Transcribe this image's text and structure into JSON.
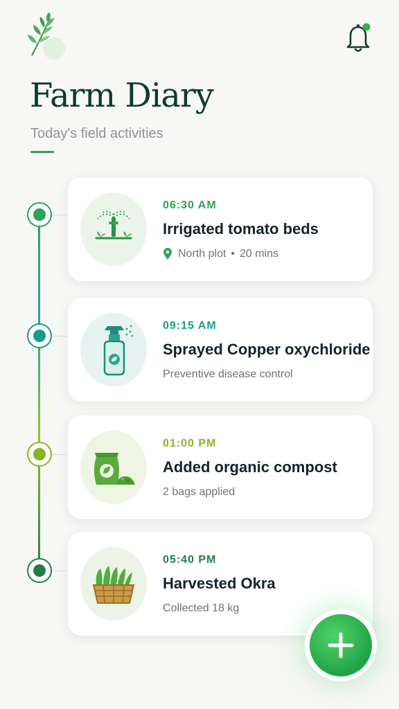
{
  "header": {
    "title": "Farm Diary",
    "subtitle": "Today's field activities",
    "logo_icon": "leaf-sprig-icon",
    "notification_icon": "bell-icon",
    "has_unread_notification": true
  },
  "colors": {
    "primary": "#2ea257",
    "title": "#0e3b2c",
    "teal": "#159c8f",
    "lime": "#8ab523",
    "dark_green": "#237e45"
  },
  "activities": [
    {
      "time": "06:30 AM",
      "title": "Irrigated tomato beds",
      "location": "North plot",
      "separator": "•",
      "duration": "20 mins",
      "icon": "sprinkler-icon",
      "accent": "#2ea257"
    },
    {
      "time": "09:15 AM",
      "title": "Sprayed Copper oxychloride",
      "detail": "Preventive disease control",
      "icon": "spray-bottle-icon",
      "accent": "#159c8f"
    },
    {
      "time": "01:00 PM",
      "title": "Added organic compost",
      "detail": "2 bags applied",
      "icon": "compost-bag-icon",
      "accent": "#8ab523"
    },
    {
      "time": "05:40 PM",
      "title": "Harvested Okra",
      "detail": "Collected 18 kg",
      "icon": "okra-basket-icon",
      "accent": "#237e45"
    }
  ],
  "fab": {
    "icon": "plus-icon"
  }
}
